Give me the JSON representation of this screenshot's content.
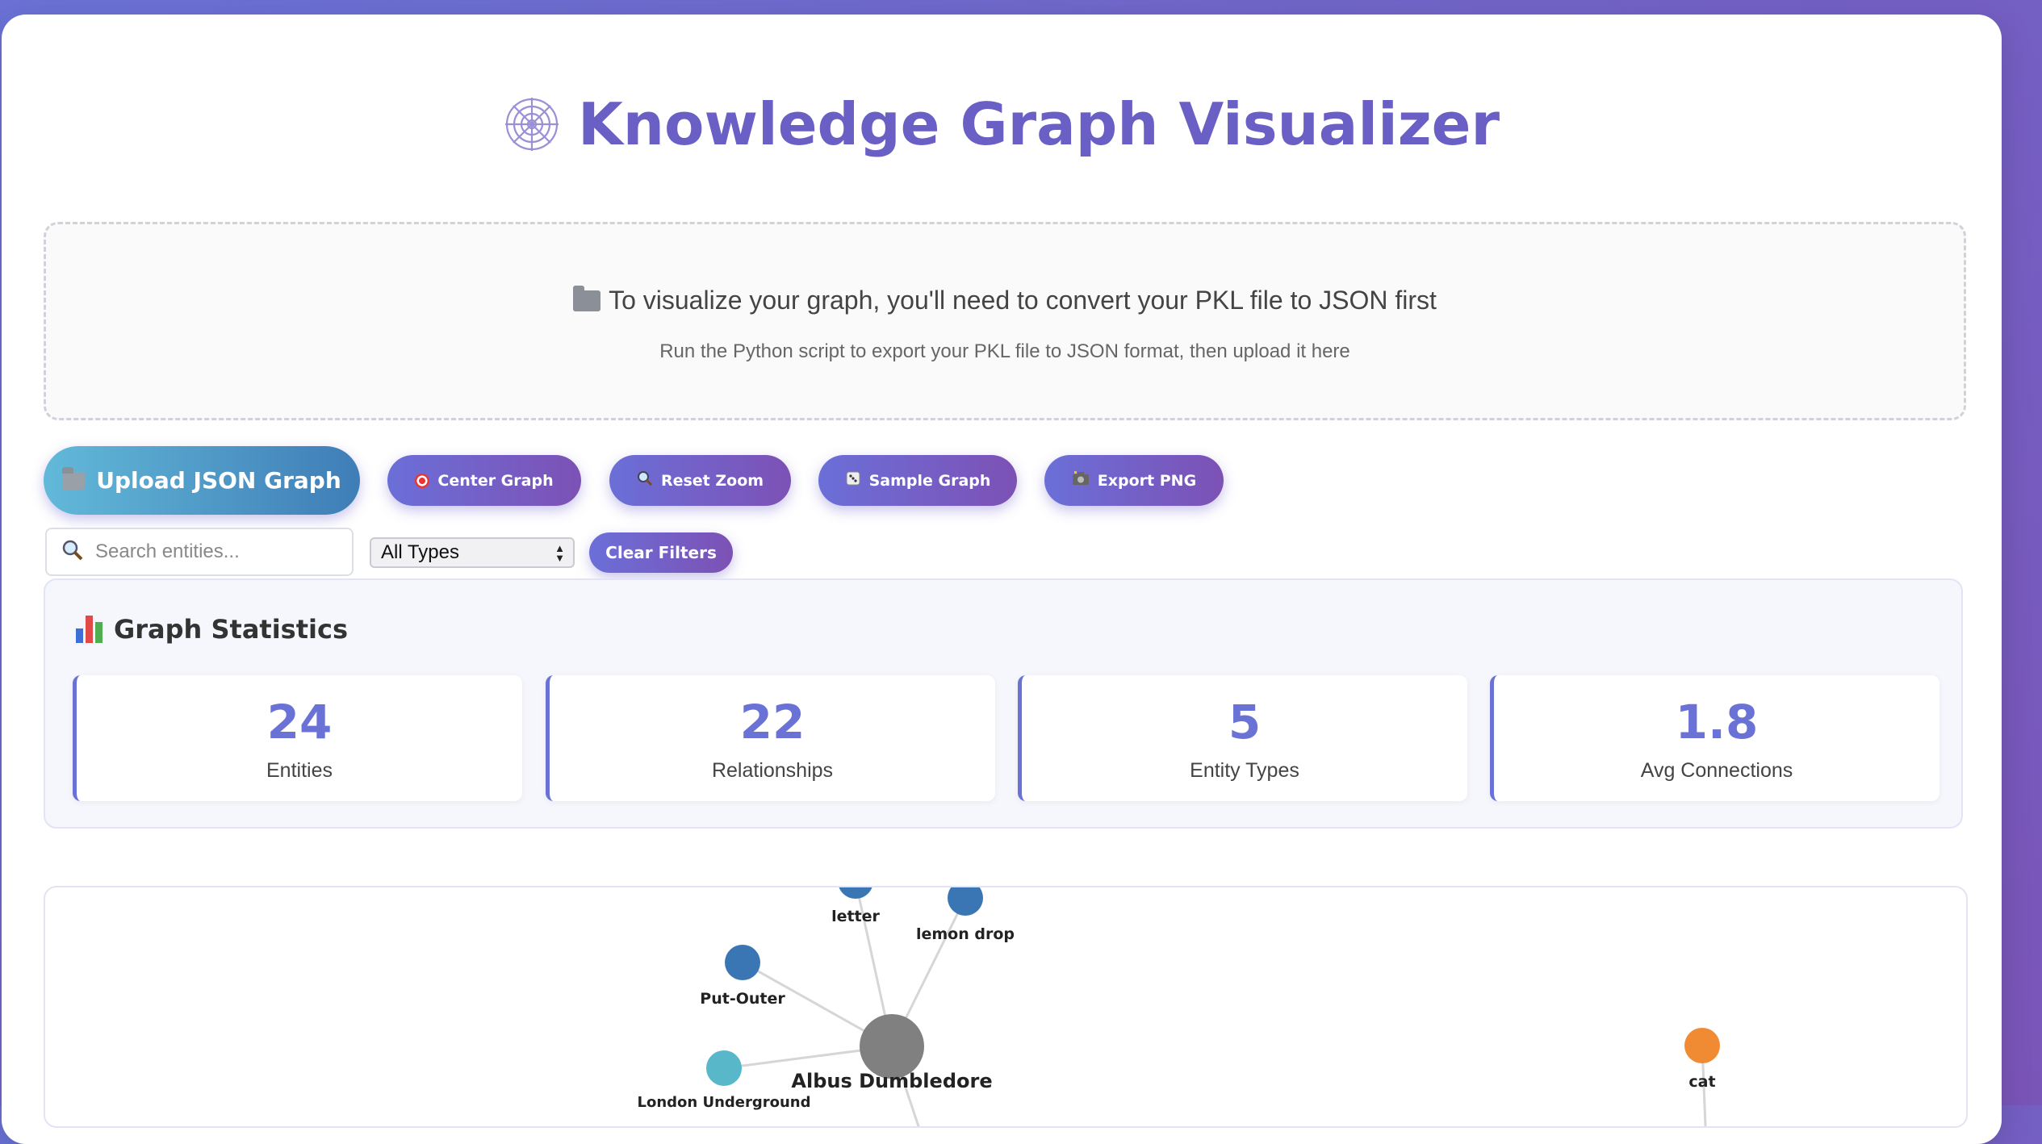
{
  "header": {
    "title": "Knowledge Graph Visualizer",
    "icon": "spider-web-icon"
  },
  "dropzone": {
    "title": "To visualize your graph, you'll need to convert your PKL file to JSON first",
    "subtitle": "Run the Python script to export your PKL file to JSON format, then upload it here",
    "icon": "folder-icon"
  },
  "toolbar": {
    "upload_label": "Upload JSON Graph",
    "center_label": "Center Graph",
    "reset_zoom_label": "Reset Zoom",
    "sample_label": "Sample Graph",
    "export_label": "Export PNG"
  },
  "filters": {
    "search_placeholder": "Search entities...",
    "type_select_value": "All Types",
    "clear_label": "Clear Filters"
  },
  "stats": {
    "title": "Graph Statistics",
    "items": [
      {
        "value": "24",
        "label": "Entities"
      },
      {
        "value": "22",
        "label": "Relationships"
      },
      {
        "value": "5",
        "label": "Entity Types"
      },
      {
        "value": "1.8",
        "label": "Avg Connections"
      }
    ]
  },
  "graph": {
    "colors": {
      "person": "#808080",
      "object": "#3a76b4",
      "place": "#58b8c9",
      "animal": "#f08a33",
      "edge": "#d6d6d6"
    },
    "nodes": [
      {
        "id": "letter",
        "label": "letter",
        "type": "object"
      },
      {
        "id": "lemon-drop",
        "label": "lemon drop",
        "type": "object"
      },
      {
        "id": "put-outer",
        "label": "Put-Outer",
        "type": "object"
      },
      {
        "id": "albus",
        "label": "Albus Dumbledore",
        "type": "person"
      },
      {
        "id": "london-underground",
        "label": "London Underground",
        "type": "place"
      },
      {
        "id": "cat",
        "label": "cat",
        "type": "animal"
      }
    ],
    "edges": [
      [
        "albus",
        "letter"
      ],
      [
        "albus",
        "lemon-drop"
      ],
      [
        "albus",
        "put-outer"
      ],
      [
        "albus",
        "london-underground"
      ]
    ]
  }
}
